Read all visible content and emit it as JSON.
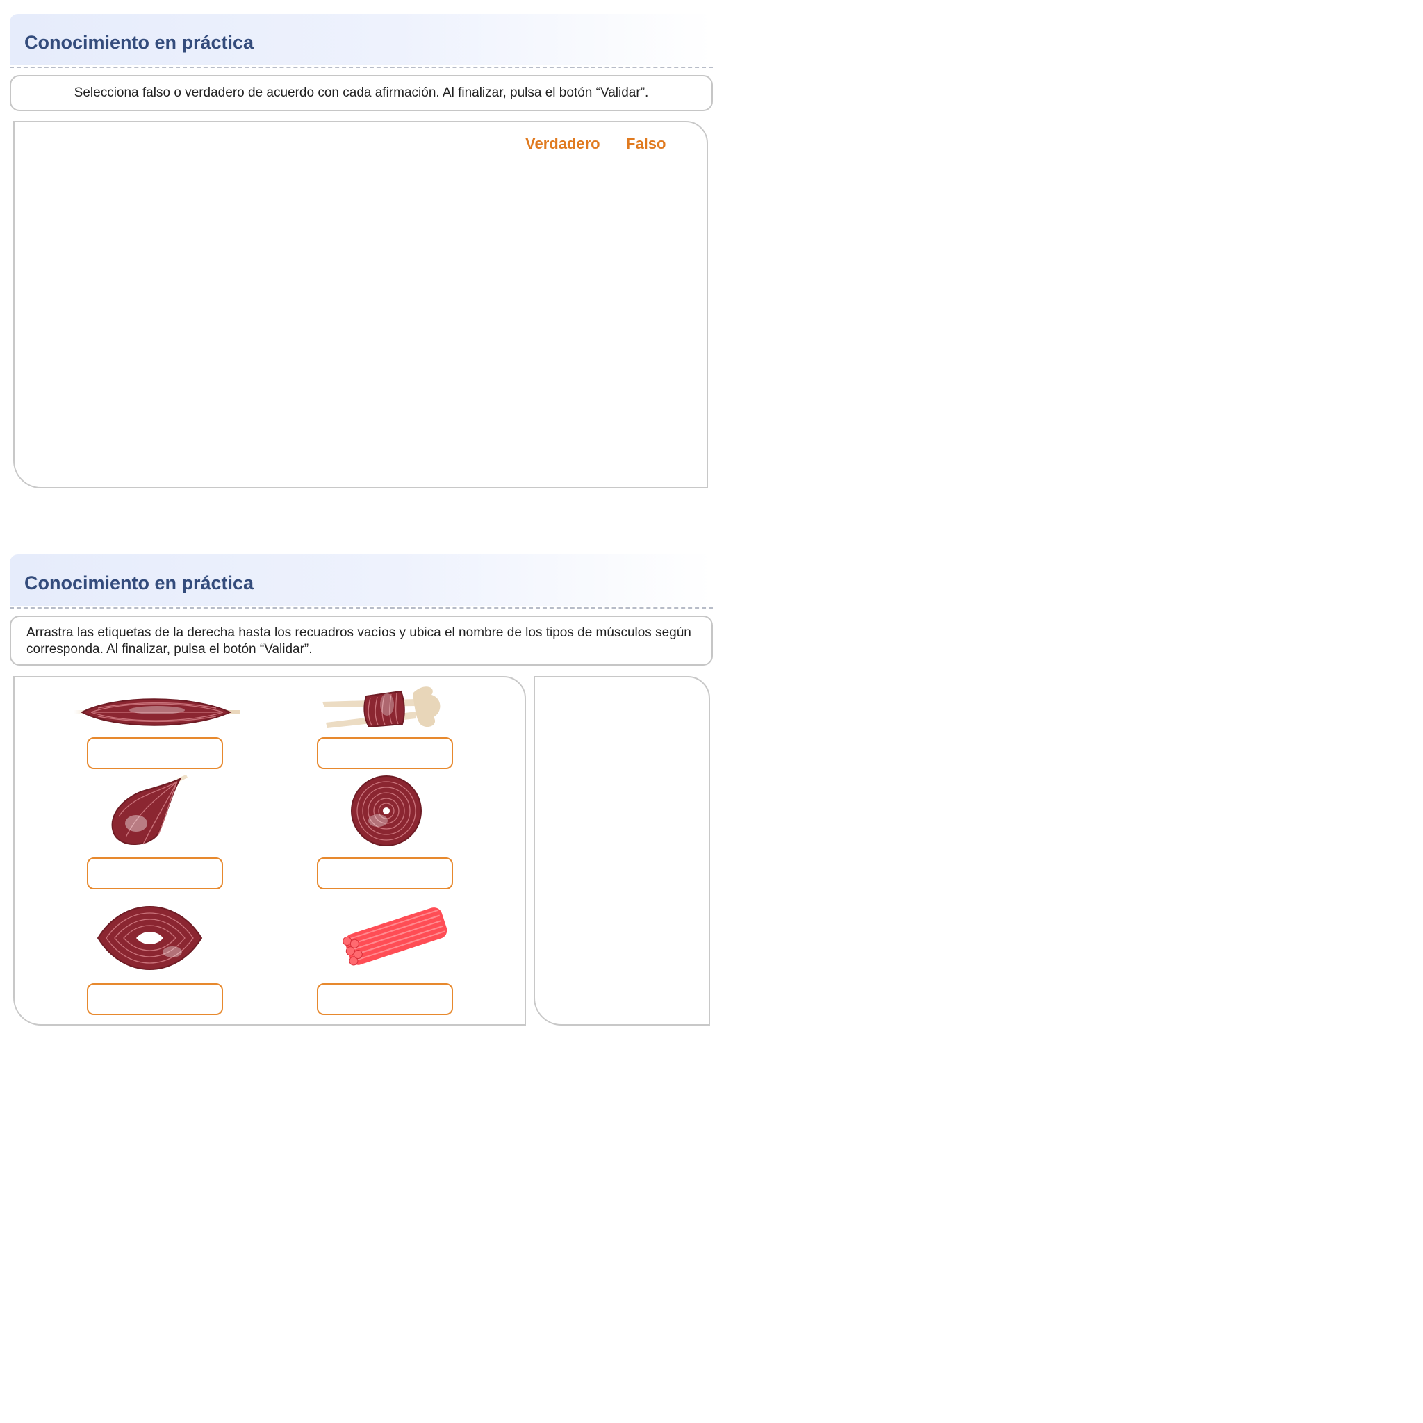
{
  "activity1": {
    "title": "Conocimiento en práctica",
    "instruction": "Selecciona falso o verdadero de acuerdo con cada afirmación. Al finalizar, pulsa el botón “Validar”.",
    "columns": {
      "true_label": "Verdadero",
      "false_label": "Falso"
    }
  },
  "activity2": {
    "title": "Conocimiento en práctica",
    "instruction": "Arrastra las etiquetas de la derecha hasta los recuadros vacíos y ubica el nombre de los tipos de músculos según corresponda. Al finalizar, pulsa el botón “Validar”.",
    "items": [
      {
        "icon": "fusiform-muscle-icon"
      },
      {
        "icon": "quadrilateral-muscle-icon"
      },
      {
        "icon": "pyriform-muscle-icon"
      },
      {
        "icon": "orbicular-muscle-icon"
      },
      {
        "icon": "orbicular-eye-muscle-icon"
      },
      {
        "icon": "muscle-fiber-bundle-icon"
      }
    ]
  },
  "colors": {
    "title": "#344c7c",
    "accent": "#e07a1f",
    "drop_border": "#e7892e",
    "muscle": "#8b2631",
    "fiber": "#ff4d55"
  }
}
